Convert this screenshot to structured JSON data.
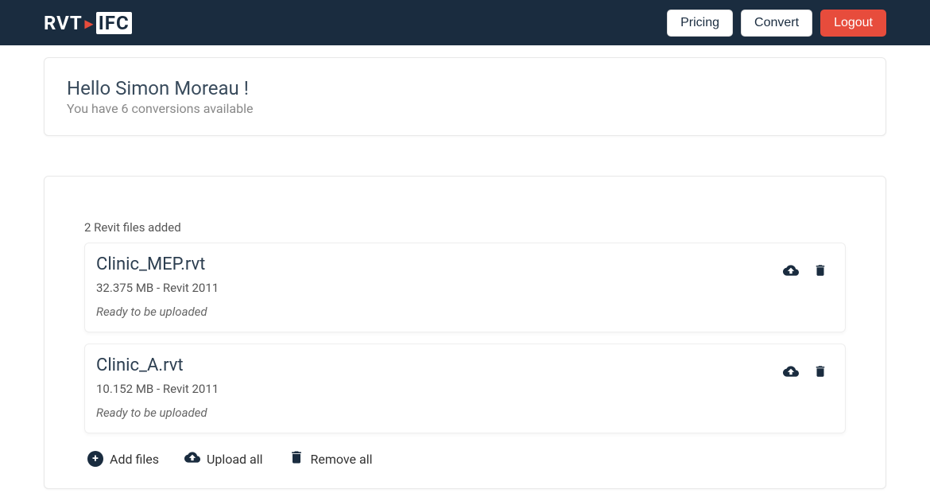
{
  "nav": {
    "logo_left": "RVT",
    "logo_right": "IFC",
    "pricing": "Pricing",
    "convert": "Convert",
    "logout": "Logout"
  },
  "welcome": {
    "title": "Hello Simon Moreau !",
    "subtitle": "You have 6 conversions available"
  },
  "files": {
    "header": "2 Revit files added",
    "items": [
      {
        "name": "Clinic_MEP.rvt",
        "meta": "32.375 MB - Revit 2011",
        "status": "Ready to be uploaded"
      },
      {
        "name": "Clinic_A.rvt",
        "meta": "10.152 MB - Revit 2011",
        "status": "Ready to be uploaded"
      }
    ]
  },
  "toolbar": {
    "add_files": "Add files",
    "upload_all": "Upload all",
    "remove_all": "Remove all"
  }
}
